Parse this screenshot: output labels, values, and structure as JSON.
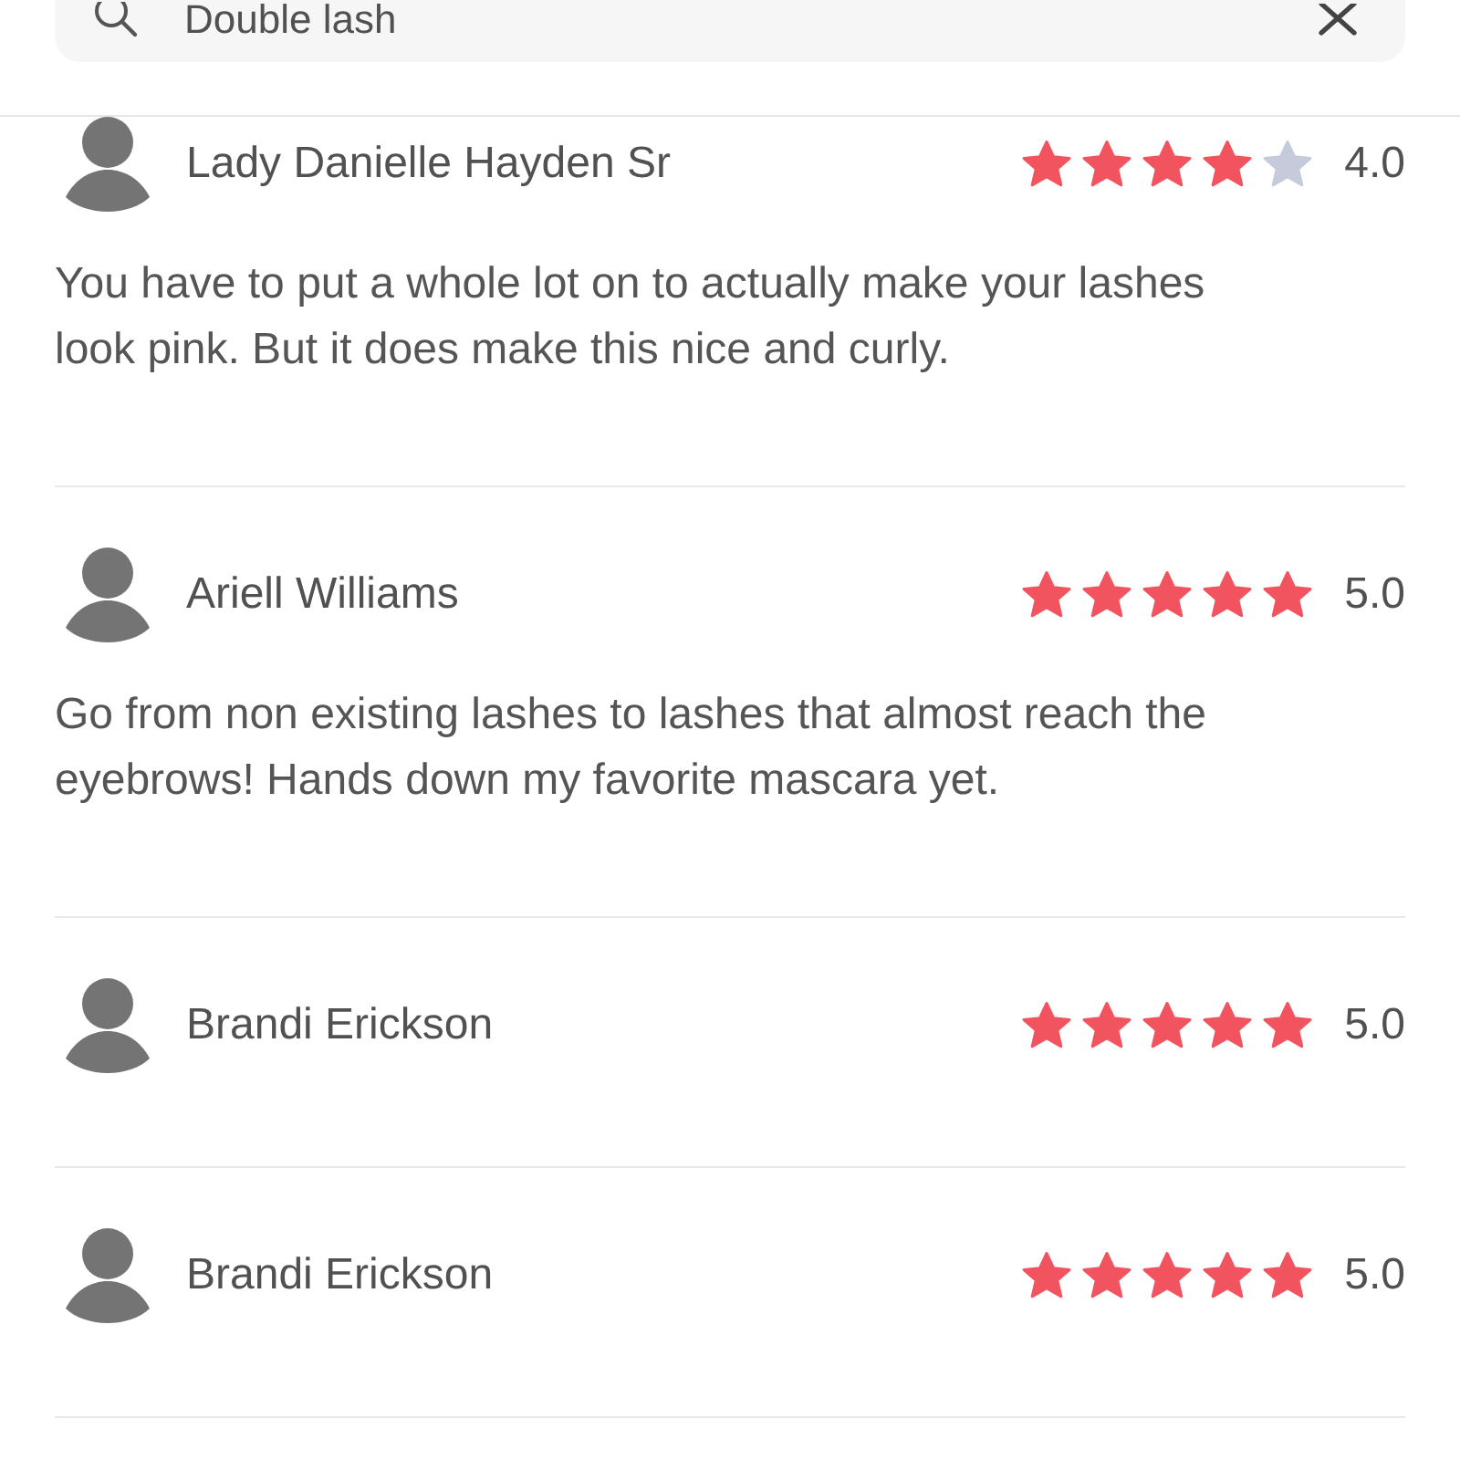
{
  "search": {
    "value": "Double lash"
  },
  "reviews": [
    {
      "name": "Lady Danielle Hayden Sr",
      "stars": 4,
      "rating": "4.0",
      "text": "You have to put a whole lot on to actually make your lashes look pink. But it does make this nice and curly."
    },
    {
      "name": "Ariell Williams",
      "stars": 5,
      "rating": "5.0",
      "text": "Go from non existing lashes to lashes that almost reach the eyebrows! Hands down my favorite mascara yet."
    },
    {
      "name": "Brandi Erickson",
      "stars": 5,
      "rating": "5.0"
    },
    {
      "name": "Brandi Erickson",
      "stars": 5,
      "rating": "5.0"
    }
  ]
}
